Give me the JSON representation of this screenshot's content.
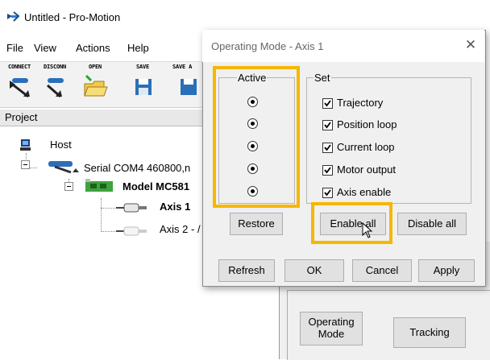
{
  "window": {
    "title": "Untitled - Pro-Motion"
  },
  "menu": [
    "File",
    "View",
    "Actions",
    "Help"
  ],
  "toolbar": {
    "items": [
      {
        "label": "CONNECT",
        "icon": "connect-icon"
      },
      {
        "label": "DISCONN",
        "icon": "disconnect-icon"
      },
      {
        "label": "OPEN",
        "icon": "open-folder-icon"
      },
      {
        "label": "SAVE",
        "icon": "save-icon"
      },
      {
        "label": "SAVE A",
        "icon": "save-as-icon"
      }
    ]
  },
  "project": {
    "header": "Project",
    "tree": {
      "host": "Host",
      "serial": "Serial COM4 460800,n",
      "model": "Model MC581",
      "axis1": "Axis 1",
      "axis2": "Axis 2 - /"
    }
  },
  "background_buttons": {
    "operating_mode": "Operating\nMode",
    "tracking": "Tracking"
  },
  "dialog": {
    "title": "Operating Mode - Axis 1",
    "active_group": "Active",
    "set_group": "Set",
    "checkboxes": [
      {
        "label": "Trajectory",
        "checked": true
      },
      {
        "label": "Position loop",
        "checked": true
      },
      {
        "label": "Current loop",
        "checked": true
      },
      {
        "label": "Motor output",
        "checked": true
      },
      {
        "label": "Axis enable",
        "checked": true
      }
    ],
    "buttons": {
      "restore": "Restore",
      "enable_all": "Enable all",
      "disable_all": "Disable all",
      "refresh": "Refresh",
      "ok": "OK",
      "cancel": "Cancel",
      "apply": "Apply"
    }
  },
  "colors": {
    "highlight": "#f5b700",
    "dialog_bg": "#f0f0f0"
  }
}
